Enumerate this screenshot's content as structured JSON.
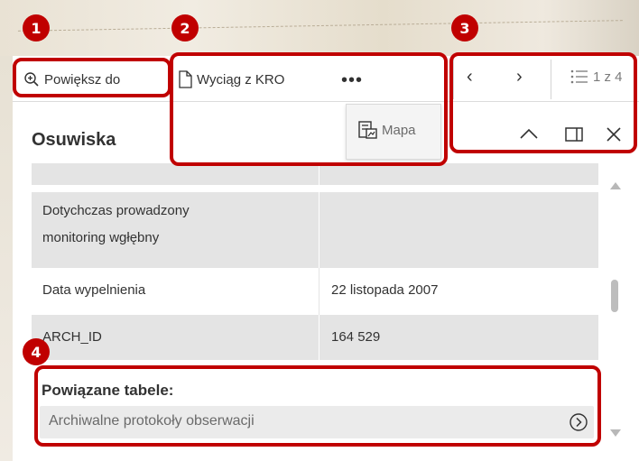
{
  "toolbar": {
    "zoom_label": "Powiększ do",
    "zoom_icon": "zoom-in-icon",
    "extract_label": "Wyciąg z KRO",
    "extract_icon": "document-icon",
    "more_label": "•••",
    "prev_label": "‹",
    "next_label": "›",
    "list_icon": "list-icon",
    "count_label": "1 z 4"
  },
  "dropdown": {
    "map_label": "Mapa",
    "map_icon": "map-icon"
  },
  "header": {
    "title": "Osuwiska",
    "collapse_icon": "chevron-up-icon",
    "dock_icon": "dock-icon",
    "close_icon": "close-icon"
  },
  "table": {
    "rows": [
      {
        "label": "",
        "value": ""
      },
      {
        "label_line1": "Dotychczas prowadzony",
        "label_line2": "monitoring wgłębny",
        "value": ""
      },
      {
        "label": "Data wypelnienia",
        "value": "22 listopada 2007"
      },
      {
        "label": "ARCH_ID",
        "value": "164 529"
      }
    ]
  },
  "related": {
    "title": "Powiązane tabele:",
    "item_label": "Archiwalne protokoły obserwacji",
    "arrow_icon": "chevron-right-circle-icon"
  },
  "annotations": {
    "badges": [
      "1",
      "2",
      "3",
      "4"
    ],
    "color": "#c00000"
  }
}
